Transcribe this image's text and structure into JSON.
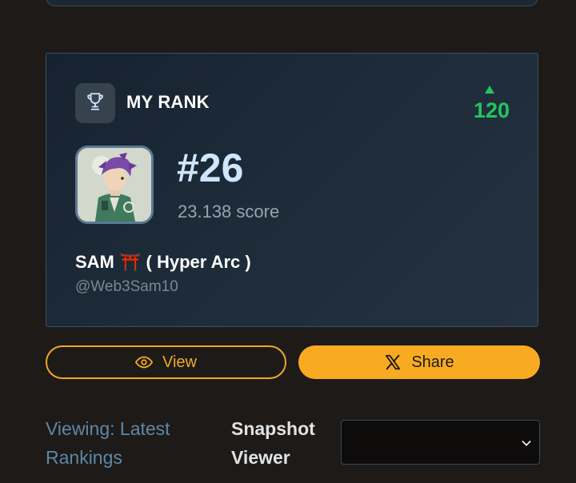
{
  "rank_card": {
    "title": "MY RANK",
    "rank_change": "120",
    "rank_change_direction": "up",
    "rank": "#26",
    "score": "23.138 score",
    "user_name": "SAM ⛩️ ( Hyper Arc )",
    "handle": "@Web3Sam10"
  },
  "actions": {
    "view_label": "View",
    "share_label": "Share"
  },
  "footer": {
    "viewing_label": "Viewing: Latest Rankings",
    "snapshot_label": "Snapshot Viewer",
    "snapshot_selected": ""
  },
  "icons": {
    "trophy": "trophy-icon",
    "eye": "eye-icon",
    "x_logo": "x-logo-icon",
    "chevron": "chevron-down-icon",
    "rank_arrow": "arrow-up-icon"
  },
  "colors": {
    "accent": "#f8ab20",
    "positive": "#22c55e",
    "rank_number": "#cfe6ff",
    "card_bg": "#1f2d3b",
    "page_bg": "#1e1a17"
  }
}
